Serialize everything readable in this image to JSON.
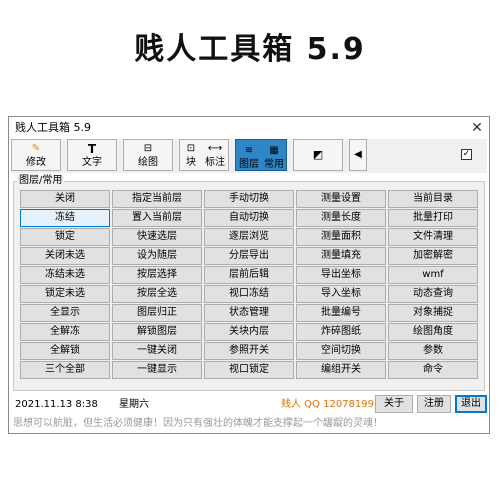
{
  "banner": {
    "title": "贱人工具箱 5.9"
  },
  "window": {
    "title": "贱人工具箱 5.9",
    "close_glyph": "✕"
  },
  "toolbar": {
    "modify": {
      "icon": "✎",
      "label": "修改"
    },
    "text": {
      "icon": "T",
      "label": "文字"
    },
    "draw": {
      "icon": "⊟",
      "label": "绘图"
    },
    "block": {
      "icon": "⊡",
      "label": "块"
    },
    "dimension": {
      "icon": "⟷",
      "label": "标注"
    },
    "layer": {
      "icon": "≋",
      "label": "图层"
    },
    "common": {
      "icon": "▦",
      "label": "常用"
    },
    "extra": {
      "icon": "◩"
    },
    "arrow": {
      "glyph": "◀"
    },
    "checkbox": {
      "mark": "✓"
    }
  },
  "group": {
    "label": "图层/常用",
    "buttons": [
      [
        "关闭",
        "指定当前层",
        "手动切换",
        "测量设置",
        "当前目录"
      ],
      [
        "冻结",
        "置入当前层",
        "自动切换",
        "测量长度",
        "批量打印"
      ],
      [
        "锁定",
        "快速选层",
        "逐层浏览",
        "测量面积",
        "文件清理"
      ],
      [
        "关闭未选",
        "设为随层",
        "分层导出",
        "测量填充",
        "加密解密"
      ],
      [
        "冻结未选",
        "按层选择",
        "层前后辑",
        "导出坐标",
        "wmf"
      ],
      [
        "锁定未选",
        "按层全选",
        "视口冻结",
        "导入坐标",
        "动态查询"
      ],
      [
        "全显示",
        "图层归正",
        "状态管理",
        "批量编号",
        "对象捕捉"
      ],
      [
        "全解冻",
        "解锁图层",
        "关块内层",
        "炸碎图纸",
        "绘图角度"
      ],
      [
        "全解锁",
        "一键关闭",
        "参照开关",
        "空间切换",
        "参数"
      ],
      [
        "三个全部",
        "一键显示",
        "视口锁定",
        "编组开关",
        "命令"
      ]
    ]
  },
  "status": {
    "date": "2021.11.13  8:38",
    "weekday": "星期六",
    "contact": "贱人 QQ 120781998",
    "about": "关于",
    "register": "注册",
    "exit": "退出"
  },
  "motto": "思想可以航脏，但生活必须健康！因为只有强壮的体魄才能支撑起一个龌龊的灵魂！",
  "colors": {
    "selected_tab": "#2f86c7",
    "contact_text": "#e0740a",
    "active_button_border": "#0078d7"
  }
}
